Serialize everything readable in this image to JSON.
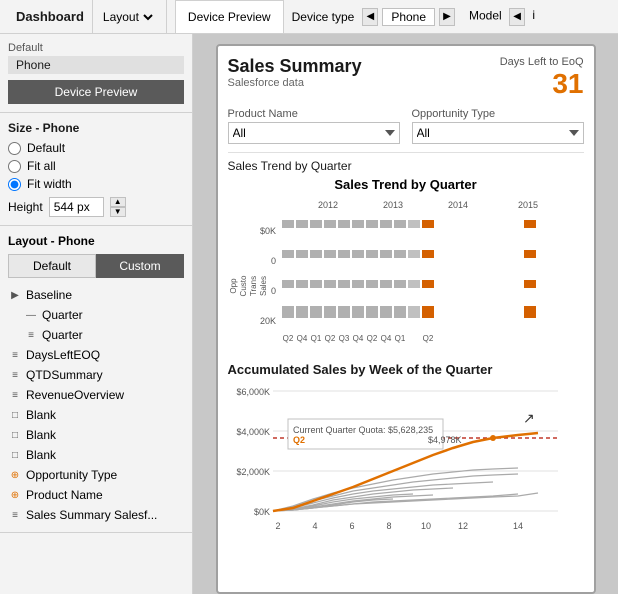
{
  "topbar": {
    "dashboard_label": "Dashboard",
    "layout_label": "Layout",
    "device_preview_tab": "Device Preview",
    "device_type_label": "Device type",
    "device_value": "Phone",
    "model_label": "Model",
    "model_value": "i"
  },
  "left": {
    "default_label": "Default",
    "phone_value": "Phone",
    "device_preview_btn": "Device Preview",
    "size_title": "Size - Phone",
    "radio_default": "Default",
    "radio_fit_all": "Fit all",
    "radio_fit_width": "Fit width",
    "height_label": "Height",
    "height_value": "544 px",
    "layout_title": "Layout - Phone",
    "toggle_default": "Default",
    "toggle_custom": "Custom",
    "tree_items": [
      {
        "icon": "▶",
        "label": "Baseline",
        "indent": 0,
        "icon_type": "arrow"
      },
      {
        "icon": "—",
        "label": "Quarter",
        "indent": 1,
        "icon_type": "dash"
      },
      {
        "icon": "≡",
        "label": "Quarter",
        "indent": 1,
        "icon_type": "lines"
      },
      {
        "icon": "≡",
        "label": "DaysLeftEOQ",
        "indent": 0,
        "icon_type": "lines"
      },
      {
        "icon": "≡",
        "label": "QTDSummary",
        "indent": 0,
        "icon_type": "lines"
      },
      {
        "icon": "≡",
        "label": "RevenueOverview",
        "indent": 0,
        "icon_type": "lines"
      },
      {
        "icon": "□",
        "label": "Blank",
        "indent": 0,
        "icon_type": "box"
      },
      {
        "icon": "□",
        "label": "Blank",
        "indent": 0,
        "icon_type": "box"
      },
      {
        "icon": "□",
        "label": "Blank",
        "indent": 0,
        "icon_type": "box"
      },
      {
        "icon": "⊕",
        "label": "Opportunity Type",
        "indent": 0,
        "icon_type": "plus-circle"
      },
      {
        "icon": "⊕",
        "label": "Product Name",
        "indent": 0,
        "icon_type": "plus-circle"
      },
      {
        "icon": "≡",
        "label": "Sales Summary   Salesf...",
        "indent": 0,
        "icon_type": "lines"
      }
    ]
  },
  "preview": {
    "title": "Sales Summary",
    "subtitle": "Salesforce data",
    "days_left_label": "Days Left to EoQ",
    "days_left_value": "31",
    "product_name_label": "Product Name",
    "product_name_value": "All",
    "opportunity_type_label": "Opportunity Type",
    "opportunity_type_value": "All",
    "section_label": "Sales Trend by Quarter",
    "trend_chart_title": "Sales Trend by Quarter",
    "trend_years": [
      "2012",
      "2013",
      "2014",
      "2015"
    ],
    "accum_chart_title": "Accumulated Sales by Week of the Quarter",
    "quota_label": "Current Quarter Quota: $5,628,235",
    "quota_highlight": "Q2",
    "quota_value": "$4,978K",
    "accum_y_labels": [
      "$6,000K",
      "$4,000K",
      "$2,000K",
      "$0K"
    ],
    "accum_x_labels": [
      "2",
      "4",
      "6",
      "8",
      "10",
      "12",
      "14"
    ],
    "trend_y_labels": [
      "$0K",
      "0",
      "0",
      "20K"
    ],
    "trend_x_labels": [
      "Q2",
      "Q4",
      "Q1",
      "Q2",
      "Q3",
      "Q4",
      "Q2",
      "Q4",
      "Q1",
      "Q2"
    ]
  }
}
